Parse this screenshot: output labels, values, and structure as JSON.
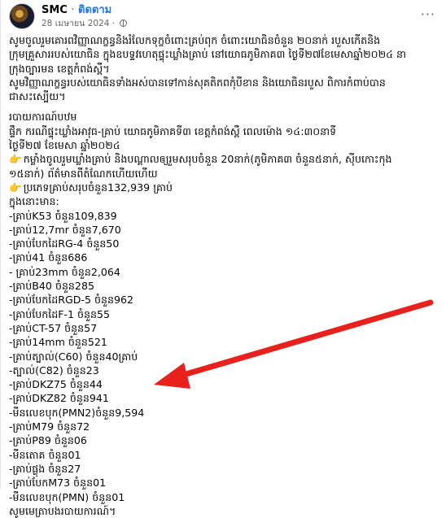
{
  "header": {
    "page_name": "SMC",
    "separator": "·",
    "follow_label": "ติดตาม",
    "date": "28 เมษายน 2024",
    "separator2": "·",
    "more_label": "···"
  },
  "post": {
    "intro_lines": [
      "សូមចូលរួមគោរពវិញ្ញាណក្ខន្ធនិងរំលែកទុក្ខចំពោះគ្រប់ពុក ចំពោះយោធិនចំនួន ២០នាក់ របួសកើតនិង",
      "ក្រុមគ្រួសាររបស់យោធិន ក្នុងឧបទ្ទវហេតុផ្ទុះឃ្លាំងគ្រាប់ នៅយោធភូមិភាគ៣ ថ្ងៃទី២៧ខែមេសាឆ្នាំ២០២៤ នា",
      "ក្រុងច្បារមន ខេត្តកំពង់ស្ពឺ។",
      "សូមវិញ្ញាណក្ខន្ធរបស់យោធិនទាំងអស់បានទៅកាន់សុគតិភពកុំបីខាន និងយោធិនរបួស ពិការកំពាប់បាន",
      "ជាសះស្បើយ។"
    ],
    "report_heading": "របាយការណ៍បឋម",
    "report_lines": [
      "ផ្ទឹក ករណីផ្ទុះឃ្លាំងអាវុធ-គ្រាប់ យោធភូមិភាគទី៣ ខេត្តកំពង់ស្ពឺ ពេលម៉ោង ១៤:៣០នាទី",
      "ថ្ងៃទី២៧ ខែមេសា ឆ្នាំ២០២៤"
    ],
    "casualty_line_1": "កម្លាំងចូលរួមឃ្លាំងគ្រាប់ និងបណ្តាលឲ្យរួមសរុបចំនួន 20នាក់(ភូមិភាគ៣ ចំនួន៥នាក់, ស៊ីបកោះកុង",
    "casualty_line_2": "១៥នាក់)   ព័ត៌មានពីតំណែកហើយហើយ",
    "total_line": "ប្រភេទគ្រាប់សរុបចំនួន132,939 គ្រាប់",
    "breakdown_heading": "ក្នុងនោះមាន:",
    "items": [
      "-គ្រាប់K53 ចំនួន109,839",
      "-គ្រាប់12,7mr ចំនួន7,670",
      "-គ្រាប់បែកដៃRG-4 ចំនួន50",
      "-គ្រាប់41 ចំនួន686",
      "- គ្រាប់23mm ចំនួន2,064",
      "-គ្រាប់B40 ចំនួន285",
      "-គ្រាប់បែកដៃRGD-5 ចំនួន962",
      "-គ្រាប់បែកដៃF-1 ចំនួន55",
      "-គ្រាប់CT-57 ចំនួន57",
      "-គ្រាប់14mm ចំនួន521",
      "-គ្រាប់ត្បាល់(C60) ចំនួន40គ្រាប់",
      "-ត្បាល់(C82) ចំនួន23",
      "-គ្រាប់DKZ75 ចំនួន44",
      "-គ្រាប់DKZ82 ចំនួន941",
      "-មីនលេខបុក(PMN2)ចំនួន9,594",
      "-គ្រាប់M79 ចំនួន72",
      "-គ្រាប់P89 ចំនួន06",
      "-មីនតោគ ចំនួន01",
      "-គ្រាប់ផ្លុង ចំនួន27",
      "-គ្រាប់បែកM73 ចំនួន01",
      "-មីនលេខបុក(PMN) ចំនួន01"
    ],
    "closing_line": "សូមមេត្រាបងរបាយការណ៍។"
  },
  "annotation": {
    "arrow_color": "#e8211c"
  }
}
